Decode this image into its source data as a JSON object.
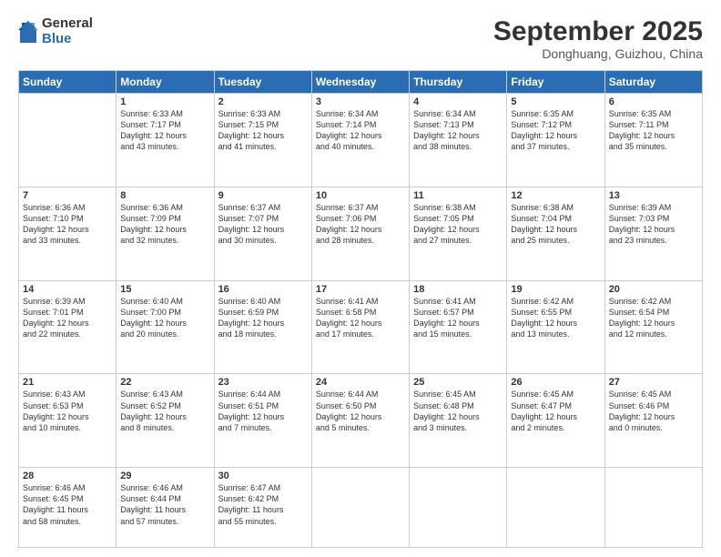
{
  "logo": {
    "general": "General",
    "blue": "Blue"
  },
  "title": "September 2025",
  "location": "Donghuang, Guizhou, China",
  "weekdays": [
    "Sunday",
    "Monday",
    "Tuesday",
    "Wednesday",
    "Thursday",
    "Friday",
    "Saturday"
  ],
  "weeks": [
    [
      {
        "day": "",
        "info": ""
      },
      {
        "day": "1",
        "info": "Sunrise: 6:33 AM\nSunset: 7:17 PM\nDaylight: 12 hours\nand 43 minutes."
      },
      {
        "day": "2",
        "info": "Sunrise: 6:33 AM\nSunset: 7:15 PM\nDaylight: 12 hours\nand 41 minutes."
      },
      {
        "day": "3",
        "info": "Sunrise: 6:34 AM\nSunset: 7:14 PM\nDaylight: 12 hours\nand 40 minutes."
      },
      {
        "day": "4",
        "info": "Sunrise: 6:34 AM\nSunset: 7:13 PM\nDaylight: 12 hours\nand 38 minutes."
      },
      {
        "day": "5",
        "info": "Sunrise: 6:35 AM\nSunset: 7:12 PM\nDaylight: 12 hours\nand 37 minutes."
      },
      {
        "day": "6",
        "info": "Sunrise: 6:35 AM\nSunset: 7:11 PM\nDaylight: 12 hours\nand 35 minutes."
      }
    ],
    [
      {
        "day": "7",
        "info": "Sunrise: 6:36 AM\nSunset: 7:10 PM\nDaylight: 12 hours\nand 33 minutes."
      },
      {
        "day": "8",
        "info": "Sunrise: 6:36 AM\nSunset: 7:09 PM\nDaylight: 12 hours\nand 32 minutes."
      },
      {
        "day": "9",
        "info": "Sunrise: 6:37 AM\nSunset: 7:07 PM\nDaylight: 12 hours\nand 30 minutes."
      },
      {
        "day": "10",
        "info": "Sunrise: 6:37 AM\nSunset: 7:06 PM\nDaylight: 12 hours\nand 28 minutes."
      },
      {
        "day": "11",
        "info": "Sunrise: 6:38 AM\nSunset: 7:05 PM\nDaylight: 12 hours\nand 27 minutes."
      },
      {
        "day": "12",
        "info": "Sunrise: 6:38 AM\nSunset: 7:04 PM\nDaylight: 12 hours\nand 25 minutes."
      },
      {
        "day": "13",
        "info": "Sunrise: 6:39 AM\nSunset: 7:03 PM\nDaylight: 12 hours\nand 23 minutes."
      }
    ],
    [
      {
        "day": "14",
        "info": "Sunrise: 6:39 AM\nSunset: 7:01 PM\nDaylight: 12 hours\nand 22 minutes."
      },
      {
        "day": "15",
        "info": "Sunrise: 6:40 AM\nSunset: 7:00 PM\nDaylight: 12 hours\nand 20 minutes."
      },
      {
        "day": "16",
        "info": "Sunrise: 6:40 AM\nSunset: 6:59 PM\nDaylight: 12 hours\nand 18 minutes."
      },
      {
        "day": "17",
        "info": "Sunrise: 6:41 AM\nSunset: 6:58 PM\nDaylight: 12 hours\nand 17 minutes."
      },
      {
        "day": "18",
        "info": "Sunrise: 6:41 AM\nSunset: 6:57 PM\nDaylight: 12 hours\nand 15 minutes."
      },
      {
        "day": "19",
        "info": "Sunrise: 6:42 AM\nSunset: 6:55 PM\nDaylight: 12 hours\nand 13 minutes."
      },
      {
        "day": "20",
        "info": "Sunrise: 6:42 AM\nSunset: 6:54 PM\nDaylight: 12 hours\nand 12 minutes."
      }
    ],
    [
      {
        "day": "21",
        "info": "Sunrise: 6:43 AM\nSunset: 6:53 PM\nDaylight: 12 hours\nand 10 minutes."
      },
      {
        "day": "22",
        "info": "Sunrise: 6:43 AM\nSunset: 6:52 PM\nDaylight: 12 hours\nand 8 minutes."
      },
      {
        "day": "23",
        "info": "Sunrise: 6:44 AM\nSunset: 6:51 PM\nDaylight: 12 hours\nand 7 minutes."
      },
      {
        "day": "24",
        "info": "Sunrise: 6:44 AM\nSunset: 6:50 PM\nDaylight: 12 hours\nand 5 minutes."
      },
      {
        "day": "25",
        "info": "Sunrise: 6:45 AM\nSunset: 6:48 PM\nDaylight: 12 hours\nand 3 minutes."
      },
      {
        "day": "26",
        "info": "Sunrise: 6:45 AM\nSunset: 6:47 PM\nDaylight: 12 hours\nand 2 minutes."
      },
      {
        "day": "27",
        "info": "Sunrise: 6:45 AM\nSunset: 6:46 PM\nDaylight: 12 hours\nand 0 minutes."
      }
    ],
    [
      {
        "day": "28",
        "info": "Sunrise: 6:46 AM\nSunset: 6:45 PM\nDaylight: 11 hours\nand 58 minutes."
      },
      {
        "day": "29",
        "info": "Sunrise: 6:46 AM\nSunset: 6:44 PM\nDaylight: 11 hours\nand 57 minutes."
      },
      {
        "day": "30",
        "info": "Sunrise: 6:47 AM\nSunset: 6:42 PM\nDaylight: 11 hours\nand 55 minutes."
      },
      {
        "day": "",
        "info": ""
      },
      {
        "day": "",
        "info": ""
      },
      {
        "day": "",
        "info": ""
      },
      {
        "day": "",
        "info": ""
      }
    ]
  ]
}
